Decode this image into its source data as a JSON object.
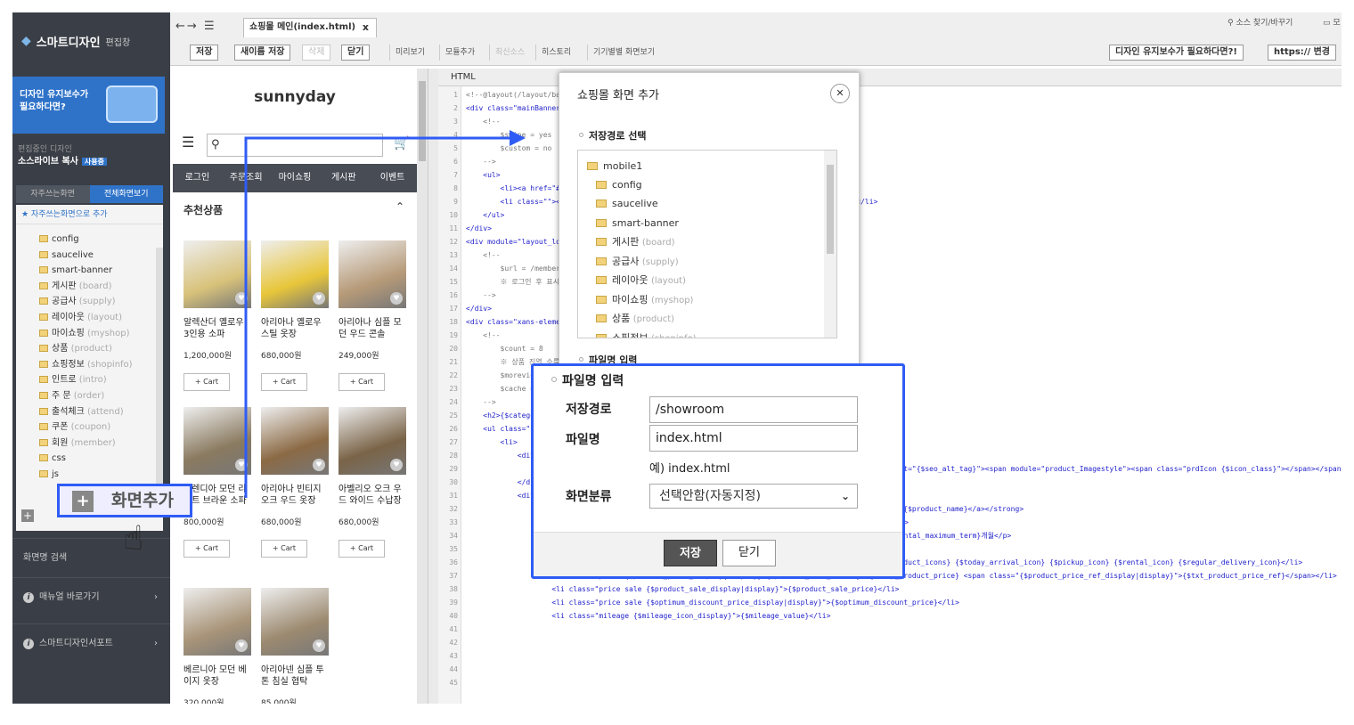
{
  "sidebar": {
    "brand": "스마트디자인",
    "brand_sub": "편집창",
    "banner_line1": "디자인 유지보수가",
    "banner_line2": "필요하다면?",
    "editing_label": "편집중인 디자인",
    "editing_name": "소스라이브 복사",
    "editing_tag": "사용중",
    "tab_frequent": "자주쓰는화면",
    "tab_all": "전체화면보기",
    "fav_add": "★ 자주쓰는화면으로 추가",
    "tree": [
      {
        "name": "config",
        "sub": ""
      },
      {
        "name": "saucelive",
        "sub": ""
      },
      {
        "name": "smart-banner",
        "sub": ""
      },
      {
        "name": "게시판",
        "sub": "(board)"
      },
      {
        "name": "공급사",
        "sub": "(supply)"
      },
      {
        "name": "레이아웃",
        "sub": "(layout)"
      },
      {
        "name": "마이쇼핑",
        "sub": "(myshop)"
      },
      {
        "name": "상품",
        "sub": "(product)"
      },
      {
        "name": "쇼핑정보",
        "sub": "(shopinfo)"
      },
      {
        "name": "인트로",
        "sub": "(intro)"
      },
      {
        "name": "주 문",
        "sub": "(order)"
      },
      {
        "name": "출석체크",
        "sub": "(attend)"
      },
      {
        "name": "쿠폰",
        "sub": "(coupon)"
      },
      {
        "name": "회원",
        "sub": "(member)"
      },
      {
        "name": "css",
        "sub": ""
      },
      {
        "name": "js",
        "sub": ""
      }
    ],
    "search_label": "화면명 검색",
    "manual_label": "매뉴얼 바로가기",
    "support_label": "스마트디자인서포트"
  },
  "toolbar": {
    "file_tab": "쇼핑몰 메인(index.html)",
    "save": "저장",
    "save_as": "새이름 저장",
    "delete": "삭제",
    "close": "닫기",
    "preview": "미리보기",
    "module": "모듈추가",
    "undo": "최신소스",
    "history": "히스토리",
    "device_preview": "기기별별 화면보기",
    "maintenance": "디자인 유지보수가 필요하다면?!",
    "https": "https:// 변경",
    "find_replace": "소스 찾기/바꾸기",
    "more": "모"
  },
  "preview": {
    "logo": "sunnyday",
    "nav": [
      "로그인",
      "주문조회",
      "마이쇼핑",
      "게시판",
      "이벤트"
    ],
    "section_title": "추천상품",
    "cart_label": "+ Cart",
    "products": [
      {
        "name": "알렉산더 옐로우 3인용 소파",
        "price": "1,200,000원",
        "color": "#d8c27a"
      },
      {
        "name": "아리아나 옐로우 스틸 옷장",
        "price": "680,000원",
        "color": "#e8c63a"
      },
      {
        "name": "아리아나 심플 모던 우드 콘솔",
        "price": "249,000원",
        "color": "#b69a78"
      },
      {
        "name": "세렌디아 모던 라인트 브라운 소파",
        "price": "800,000원",
        "color": "#8a7a60"
      },
      {
        "name": "아리아나 빈티지 오크 우드 옷장",
        "price": "680,000원",
        "color": "#8b6a45"
      },
      {
        "name": "아벨리오 오크 우드 와이드 수납장",
        "price": "680,000원",
        "color": "#7a6448"
      },
      {
        "name": "베르니아 모던 베이지 옷장",
        "price": "320,000원",
        "color": "#a89478"
      },
      {
        "name": "아리아넨 심플 투톤 침실 협탁",
        "price": "85,000원",
        "color": "#9c8a70"
      }
    ]
  },
  "editor": {
    "tab": "HTML",
    "lines": [
      "<!--@layout(/layout/basic/main.html)-->",
      "",
      "<div class=\"mainBanner\">",
      "    <!--",
      "        $swipe = yes",
      "        $custom = no",
      "    -->",
      "    <ul>",
      "        <li><a href=\"#\"><img src=\"/web/upload/image.jpg\" width=\"100%\" alt=\"\"></a></li>",
      "        <li class=\"\"><a href=\"{$link_url}\"><img src=\"{$image_url}\" width=\"100%\" alt=\"\"></a></li>",
      "    </ul>",
      "</div>",
      "",
      "<div module=\"layout_logon\">",
      "    <!--",
      "        $url = /member/login.html",
      "        ※ 로그인 후 표시됩니다",
      "    -->",
      "</div>",
      "",
      "<div class=\"xans-element\">",
      "    <!--",
      "        $count = 8",
      "        ※ 상품 진열 수를 설정하시면 됩니다.",
      "",
      "        $moreview = yes",
      "        $cache = no",
      "    -->",
      "    <h2>{$category_name}</h2>",
      "    <ul class=\"prdList\">",
      "        <li>",
      "            <div class=\"thumbnail\">",
      "                <a href=\"{$link_product_detail}\"><img src=\"{$image_medium}\" id=\"{$image_medium_id}\" alt=\"{$seo_alt_tag}\"><span module=\"product_Imagestyle\"><span class=\"prdIcon {$icon_class}\"></span></span></a>",
      "",
      "            </div>",
      "            <div class=\"description\">",
      "                <strong class=\"name {$product_name_display|display}\"><a href=\"{$link_product_detail}\">{$product_name}</a></strong>",
      "                <p class=\"ec-base-help txtWarn txt11 {$exclusive_purchase_olny|display}\"> 단독구매상품</p>",
      "                <p class=\"name {$rental_icon|display}\">월 {$rental_maximum_price|numberformat}원 / {$rental_maximum_term}개월</p>",
      "                <ul class=\"spec\">",
      "                    <li class=\"icon\">{$soldout_icon} {$stock_icon} {$new_icon} {$recommend_icon} {$product_icons} {$today_arrival_icon} {$pickup_icon} {$rental_icon} {$regular_delivery_icon}</li>",
      "                    <li class=\"price {$product_price_display|display} {$product_sale_strike}\">{$disp_product_price} <span class=\"{$product_price_ref_display|display}\">{$txt_product_price_ref}</span></li>",
      "                    <li class=\"price sale {$product_sale_display|display}\">{$product_sale_price}</li>",
      "                    <li class=\"price sale {$optimum_discount_price_display|display}\">{$optimum_discount_price}</li>",
      "                    <li class=\"mileage {$mileage_icon_display}\">{$mileage_value}</li>"
    ]
  },
  "modal": {
    "title": "쇼핑몰 화면 추가",
    "section_path": "저장경로 선택",
    "tree_root": "mobile1",
    "tree": [
      {
        "name": "config",
        "sub": ""
      },
      {
        "name": "saucelive",
        "sub": ""
      },
      {
        "name": "smart-banner",
        "sub": ""
      },
      {
        "name": "게시판",
        "sub": "(board)"
      },
      {
        "name": "공급사",
        "sub": "(supply)"
      },
      {
        "name": "레이아웃",
        "sub": "(layout)"
      },
      {
        "name": "마이쇼핑",
        "sub": "(myshop)"
      },
      {
        "name": "상품",
        "sub": "(product)"
      },
      {
        "name": "쇼핑정보",
        "sub": "(shopinfo)"
      }
    ],
    "section_filename": "파일명 입력"
  },
  "zoom": {
    "title": "파일명 입력",
    "path_label": "저장경로",
    "path_value": "/showroom",
    "name_label": "파일명",
    "name_value": "index.html",
    "example": "예) index.html",
    "category_label": "화면분류",
    "category_value": "선택안함(자동지정)",
    "save": "저장",
    "close": "닫기"
  },
  "callout": {
    "label": "화면추가"
  },
  "colors": {
    "sidebar": "#3a3f47",
    "accent": "#2f73c9",
    "highlight": "#2f5cf5"
  }
}
